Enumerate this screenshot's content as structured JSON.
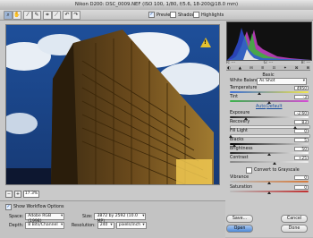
{
  "window": {
    "title": "Nikon D200:  DSC_0009.NEF  (ISO 100, 1/80, f/5.6, 18-200@18.0 mm)"
  },
  "toolbar": {
    "tools": [
      {
        "name": "zoom-icon",
        "glyph": "⌕"
      },
      {
        "name": "hand-icon",
        "glyph": "✋"
      },
      {
        "name": "eyedropper-icon",
        "glyph": "⁄"
      },
      {
        "name": "color-sampler-icon",
        "glyph": "✎"
      },
      {
        "name": "crop-icon",
        "glyph": "⌗"
      },
      {
        "name": "straighten-icon",
        "glyph": "⟋"
      },
      {
        "name": "rotate-ccw-icon",
        "glyph": "↶"
      },
      {
        "name": "rotate-cw-icon",
        "glyph": "↷"
      }
    ],
    "preview_label": "Preview",
    "shadows_label": "Shadows",
    "highlights_label": "Highlights"
  },
  "zoom": {
    "value": "17.3%",
    "minus": "−",
    "plus": "+"
  },
  "histogram": {
    "r_label": "R:",
    "g_label": "G:",
    "b_label": "B:",
    "r": "---",
    "g": "---",
    "b": "---"
  },
  "tabs": [
    "◐",
    "▲",
    "⊟",
    "≡",
    "⊡",
    "✦",
    "⊠",
    "⊞"
  ],
  "basic": {
    "title": "Basic",
    "white_balance_label": "White Balance:",
    "white_balance_value": "As Shot",
    "temperature_label": "Temperature",
    "temperature_value": "4950",
    "tint_label": "Tint",
    "tint_value": "-3",
    "auto_label": "Auto",
    "default_label": "Default",
    "exposure_label": "Exposure",
    "exposure_value": "-2.60",
    "recovery_label": "Recovery",
    "recovery_value": "83",
    "fill_light_label": "Fill Light",
    "fill_light_value": "0",
    "blacks_label": "Blacks",
    "blacks_value": "5",
    "brightness_label": "Brightness",
    "brightness_value": "50",
    "contrast_label": "Contrast",
    "contrast_value": "+25",
    "grayscale_label": "Convert to Grayscale",
    "vibrance_label": "Vibrance",
    "vibrance_value": "0",
    "saturation_label": "Saturation",
    "saturation_value": "0"
  },
  "options": {
    "workflow_label": "Show Workflow Options",
    "space_label": "Space:",
    "space_value": "Adobe RGB (1998)",
    "depth_label": "Depth:",
    "depth_value": "8 Bits/Channel",
    "size_label": "Size:",
    "size_value": "3872 by 2592 (10.0 MP)",
    "resolution_label": "Resolution:",
    "resolution_value": "240",
    "resolution_unit": "pixels/inch"
  },
  "buttons": {
    "save": "Save...",
    "cancel": "Cancel",
    "open": "Open",
    "done": "Done"
  },
  "colors": {
    "accent": "#4d88d6",
    "warning": "#e5c12f"
  }
}
